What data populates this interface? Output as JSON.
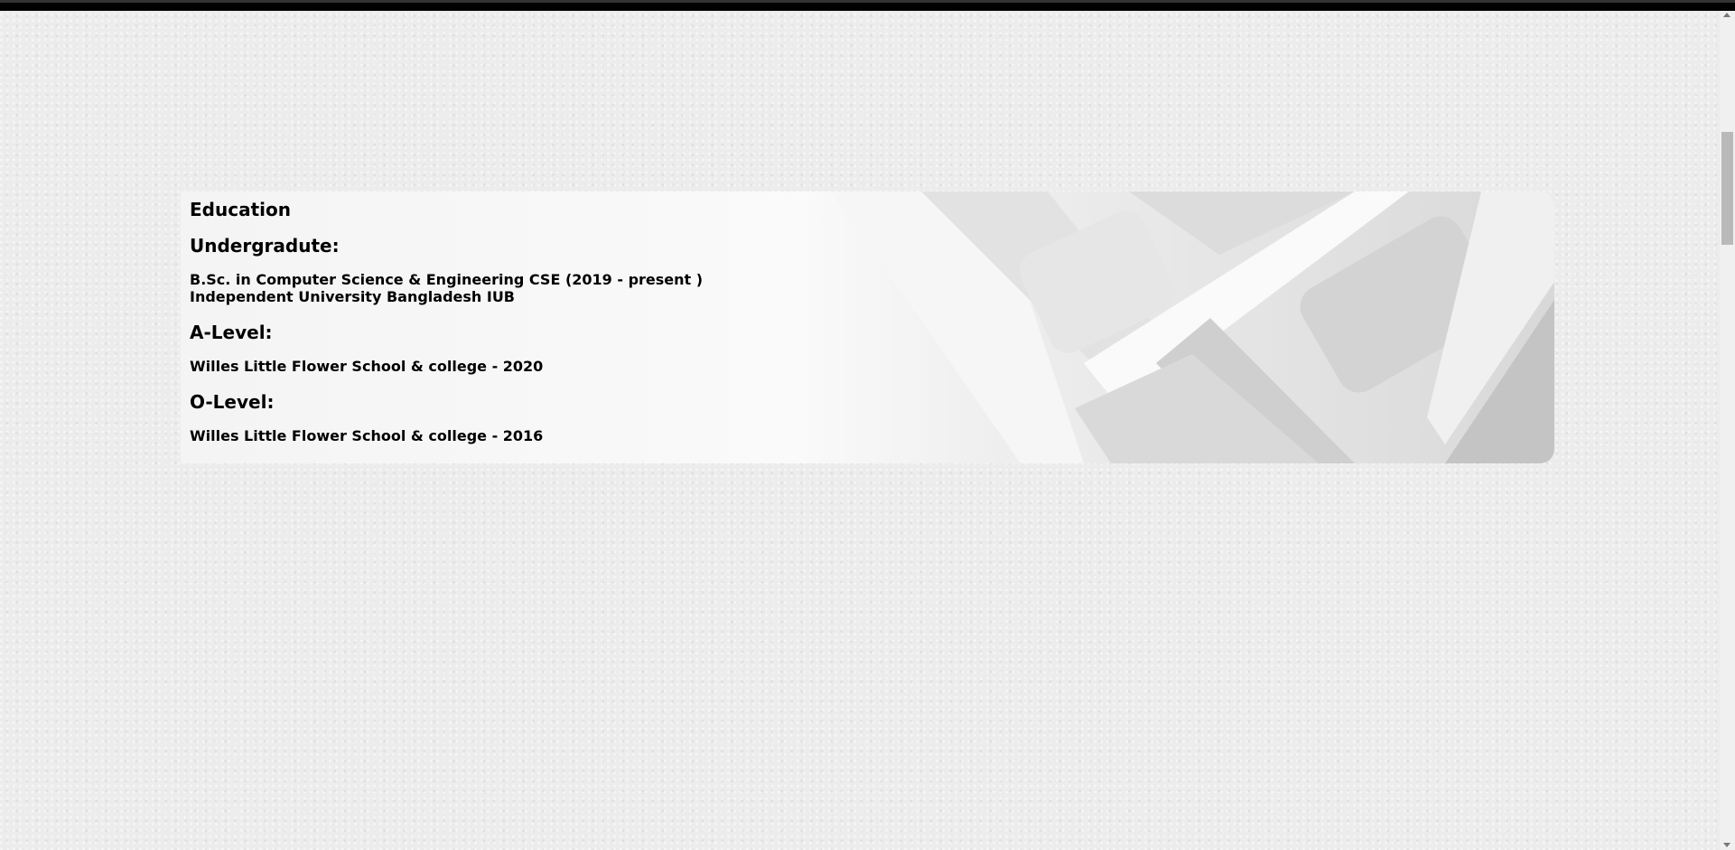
{
  "education": {
    "title": "Education",
    "sections": [
      {
        "heading": "Undergradute:",
        "lines": [
          "B.Sc. in Computer Science & Engineering CSE (2019 - present )",
          "Independent University Bangladesh IUB"
        ]
      },
      {
        "heading": "A-Level:",
        "lines": [
          "Willes Little Flower School & college - 2020"
        ]
      },
      {
        "heading": "O-Level:",
        "lines": [
          "Willes Little Flower School & college - 2016"
        ]
      }
    ]
  }
}
